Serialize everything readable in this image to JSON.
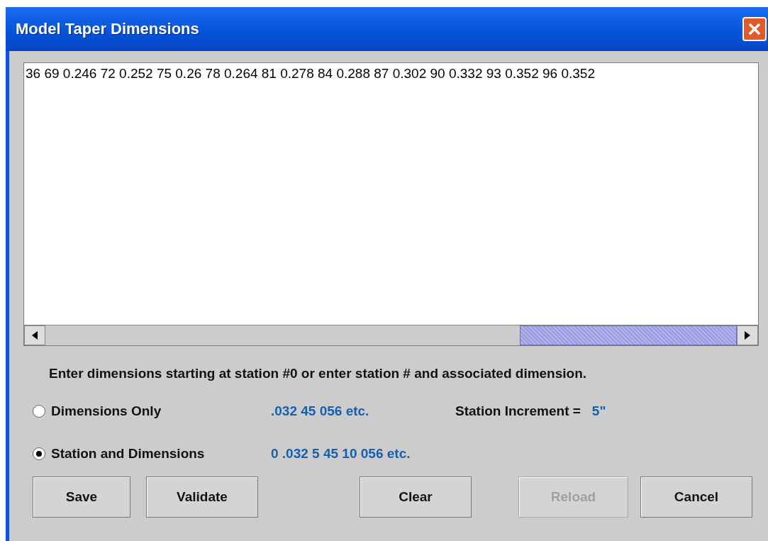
{
  "window": {
    "title": "Model Taper Dimensions"
  },
  "text_area": {
    "value": "36 69 0.246 72 0.252 75 0.26 78 0.264 81 0.278 84 0.288 87 0.302 90 0.332 93 0.352 96 0.352"
  },
  "instruction": "Enter dimensions starting at station #0 or enter station # and associated dimension.",
  "options": [
    {
      "label": "Dimensions Only",
      "selected": false,
      "example": ".032 45 056 etc."
    },
    {
      "label": "Station and Dimensions",
      "selected": true,
      "example": "0 .032 5 45 10 056 etc."
    }
  ],
  "station_increment": {
    "label": "Station Increment =",
    "value": "5\""
  },
  "buttons": [
    {
      "label": "Save",
      "disabled": false
    },
    {
      "label": "Validate",
      "disabled": false
    },
    {
      "label": "Clear",
      "disabled": false
    },
    {
      "label": "Reload",
      "disabled": true
    },
    {
      "label": "Cancel",
      "disabled": false
    }
  ]
}
